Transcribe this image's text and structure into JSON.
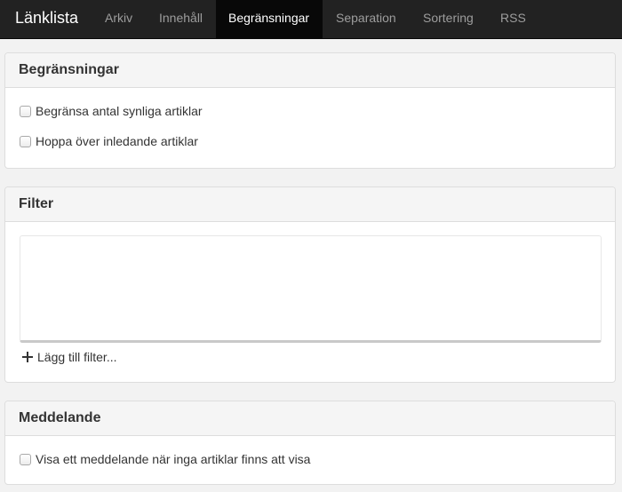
{
  "navbar": {
    "brand": "Länklista",
    "tabs": [
      {
        "label": "Arkiv",
        "active": false
      },
      {
        "label": "Innehåll",
        "active": false
      },
      {
        "label": "Begränsningar",
        "active": true
      },
      {
        "label": "Separation",
        "active": false
      },
      {
        "label": "Sortering",
        "active": false
      },
      {
        "label": "RSS",
        "active": false
      }
    ]
  },
  "limits": {
    "title": "Begränsningar",
    "options": [
      {
        "label": "Begränsa antal synliga artiklar",
        "checked": false
      },
      {
        "label": "Hoppa över inledande artiklar",
        "checked": false
      }
    ]
  },
  "filter": {
    "title": "Filter",
    "add_label": "Lägg till filter..."
  },
  "message": {
    "title": "Meddelande",
    "option": {
      "label": "Visa ett meddelande när inga artiklar finns att visa",
      "checked": false
    }
  },
  "colors": {
    "navbar_bg": "#222222",
    "active_tab_bg": "#080808",
    "inactive_tab_text": "#9d9d9d",
    "panel_heading_bg": "#f5f5f5"
  }
}
